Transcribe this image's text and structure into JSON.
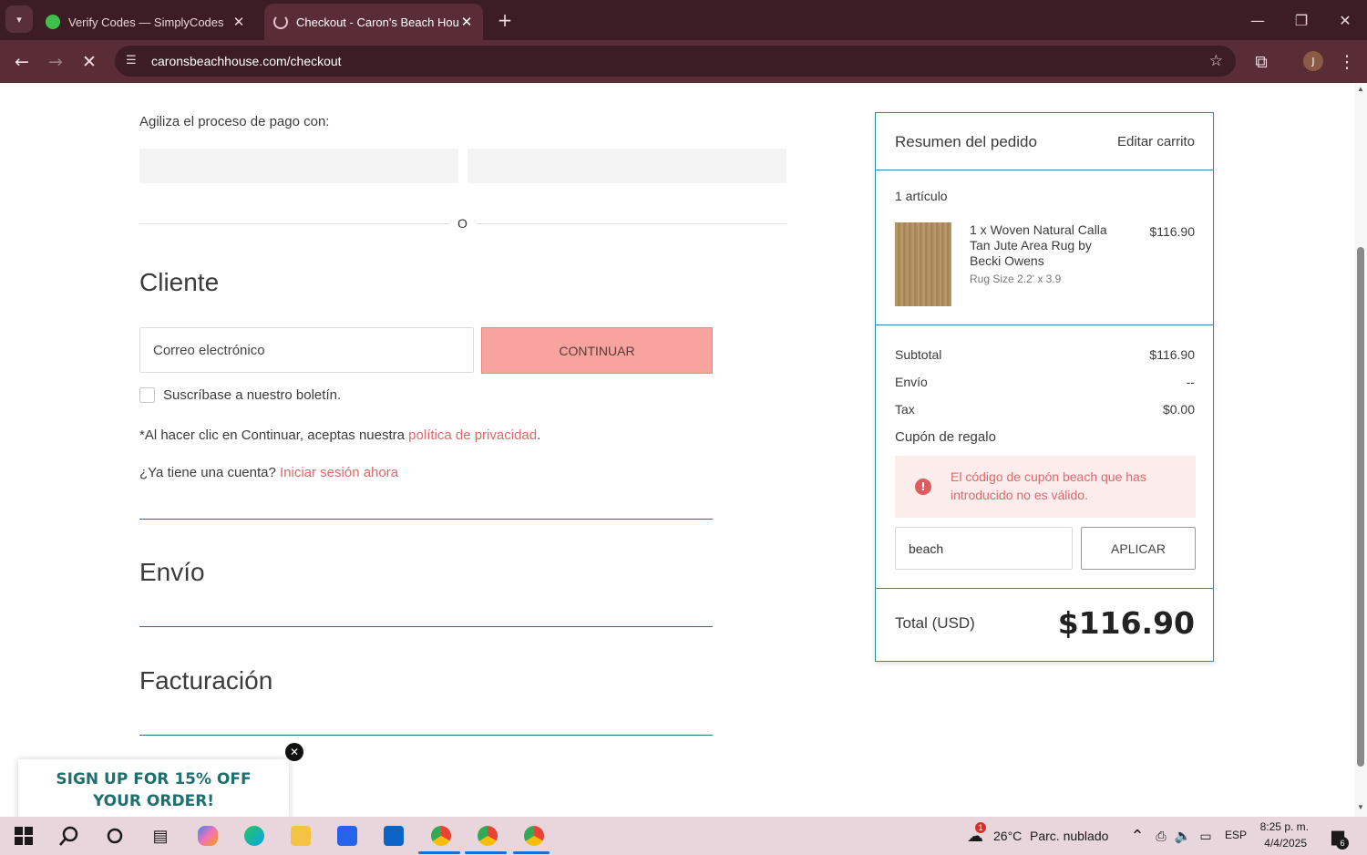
{
  "browser": {
    "tabs": [
      {
        "title": "Verify Codes — SimplyCodes",
        "active": false
      },
      {
        "title": "Checkout - Caron's Beach Hous",
        "active": true
      }
    ],
    "url": "caronsbeachhouse.com/checkout",
    "profile_initial": "J",
    "accent_color": "#5a2c36"
  },
  "checkout": {
    "express_label": "Agiliza el proceso de pago con:",
    "or_label": "O",
    "customer_heading": "Cliente",
    "email_placeholder": "Correo electrónico",
    "continue_label": "CONTINUAR",
    "newsletter_label": "Suscríbase a nuestro boletín.",
    "privacy_prefix": "*Al hacer clic en Continuar, aceptas nuestra ",
    "privacy_link": "política de privacidad",
    "privacy_suffix": ".",
    "account_prefix": "¿Ya tiene una cuenta? ",
    "signin_link": "Iniciar sesión ahora",
    "shipping_heading": "Envío",
    "billing_heading": "Facturación"
  },
  "summary": {
    "title": "Resumen del pedido",
    "edit_cart": "Editar carrito",
    "item_count": "1 artículo",
    "item": {
      "name_lines": [
        "1 x Woven Natural Calla",
        "Tan Jute Area Rug by",
        "Becki Owens"
      ],
      "variant": "Rug Size 2.2' x 3.9",
      "price": "$116.90"
    },
    "subtotal_label": "Subtotal",
    "subtotal_value": "$116.90",
    "shipping_label": "Envío",
    "shipping_value": "--",
    "tax_label": "Tax",
    "tax_value": "$0.00",
    "coupon_label": "Cupón de regalo",
    "error_message": "El código de cupón beach que has introducido no es válido.",
    "coupon_value": "beach",
    "apply_label": "APLICAR",
    "total_label": "Total (USD)",
    "total_value": "$116.90"
  },
  "promo": {
    "text": "SIGN UP FOR 15% OFF YOUR ORDER!"
  },
  "taskbar": {
    "weather_temp": "26°C",
    "weather_desc": "Parc. nublado",
    "weather_badge": "1",
    "language": "ESP",
    "time": "8:25 p. m.",
    "date": "4/4/2025",
    "notification_count": "6"
  }
}
